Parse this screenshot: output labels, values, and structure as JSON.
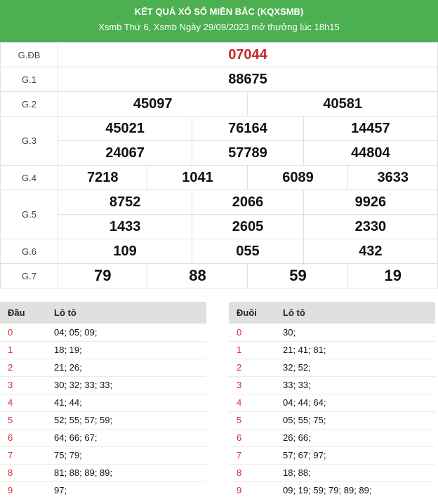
{
  "header": {
    "title": "KẾT QUẢ XỔ SỐ MIỀN BẮC (KQXSMB)",
    "subtitle": "Xsmb Thứ 6, Xsmb Ngày 29/09/2023 mở thưởng lúc 18h15"
  },
  "prizes": {
    "gdb": {
      "label": "G.ĐB",
      "numbers": [
        "07044"
      ]
    },
    "g1": {
      "label": "G.1",
      "numbers": [
        "88675"
      ]
    },
    "g2": {
      "label": "G.2",
      "numbers": [
        "45097",
        "40581"
      ]
    },
    "g3": {
      "label": "G.3",
      "numbers": [
        "45021",
        "76164",
        "14457",
        "24067",
        "57789",
        "44804"
      ]
    },
    "g4": {
      "label": "G.4",
      "numbers": [
        "7218",
        "1041",
        "6089",
        "3633"
      ]
    },
    "g5": {
      "label": "G.5",
      "numbers": [
        "8752",
        "2066",
        "9926",
        "1433",
        "2605",
        "2330"
      ]
    },
    "g6": {
      "label": "G.6",
      "numbers": [
        "109",
        "055",
        "432"
      ]
    },
    "g7": {
      "label": "G.7",
      "numbers": [
        "79",
        "88",
        "59",
        "19"
      ]
    }
  },
  "dau_table": {
    "col1": "Đầu",
    "col2": "Lô tô",
    "rows": [
      {
        "key": "0",
        "value": "04; 05; 09;"
      },
      {
        "key": "1",
        "value": "18; 19;"
      },
      {
        "key": "2",
        "value": "21; 26;"
      },
      {
        "key": "3",
        "value": "30; 32; 33; 33;"
      },
      {
        "key": "4",
        "value": "41; 44;"
      },
      {
        "key": "5",
        "value": "52; 55; 57; 59;"
      },
      {
        "key": "6",
        "value": "64; 66; 67;"
      },
      {
        "key": "7",
        "value": "75; 79;"
      },
      {
        "key": "8",
        "value": "81; 88; 89; 89;"
      },
      {
        "key": "9",
        "value": "97;"
      }
    ]
  },
  "duoi_table": {
    "col1": "Đuôi",
    "col2": "Lô tô",
    "rows": [
      {
        "key": "0",
        "value": "30;"
      },
      {
        "key": "1",
        "value": "21; 41; 81;"
      },
      {
        "key": "2",
        "value": "32; 52;"
      },
      {
        "key": "3",
        "value": "33; 33;"
      },
      {
        "key": "4",
        "value": "04; 44; 64;"
      },
      {
        "key": "5",
        "value": "05; 55; 75;"
      },
      {
        "key": "6",
        "value": "26; 66;"
      },
      {
        "key": "7",
        "value": "57; 67; 97;"
      },
      {
        "key": "8",
        "value": "18; 88;"
      },
      {
        "key": "9",
        "value": "09; 19; 59; 79; 89; 89;"
      }
    ]
  },
  "colors": {
    "header_bg": "#4caf50",
    "special_prize": "#c62828",
    "loto_key": "#d32f2f"
  }
}
